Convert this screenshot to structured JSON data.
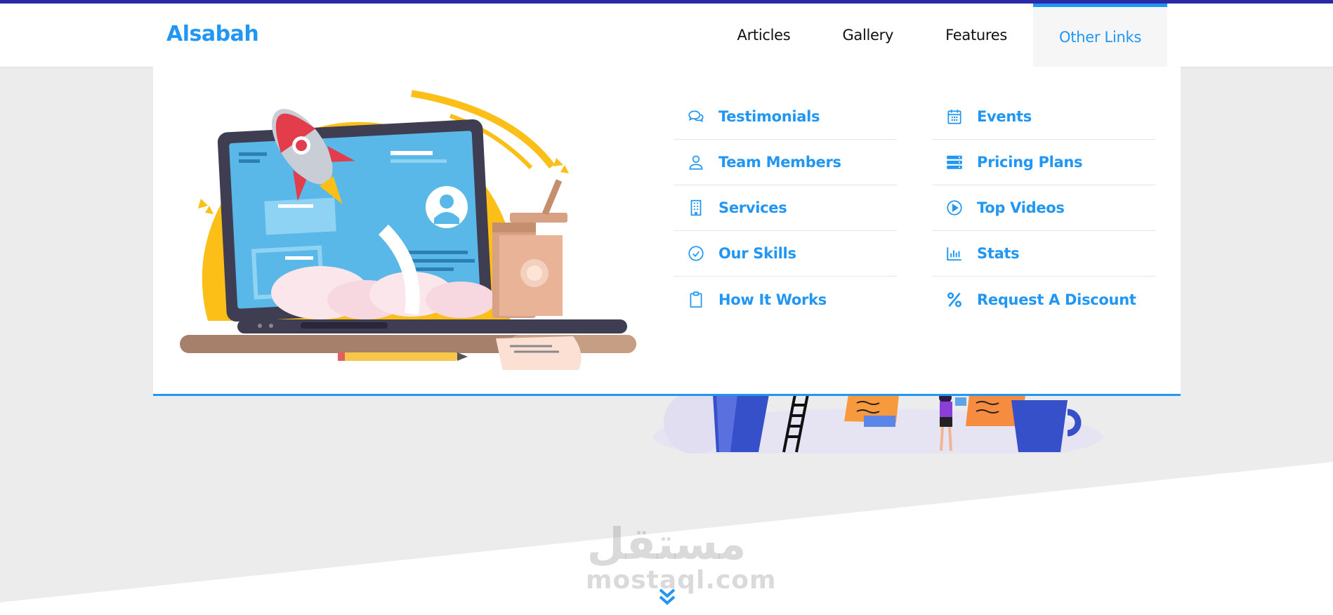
{
  "header": {
    "logo": "Alsabah",
    "nav": [
      {
        "label": "Articles"
      },
      {
        "label": "Gallery"
      },
      {
        "label": "Features"
      },
      {
        "label": "Other Links"
      }
    ]
  },
  "mega_menu": {
    "left_column": [
      {
        "label": "Testimonials",
        "icon": "comments-icon"
      },
      {
        "label": "Team Members",
        "icon": "user-icon"
      },
      {
        "label": "Services",
        "icon": "building-icon"
      },
      {
        "label": "Our Skills",
        "icon": "check-circle-icon"
      },
      {
        "label": "How It Works",
        "icon": "clipboard-icon"
      }
    ],
    "right_column": [
      {
        "label": "Events",
        "icon": "calendar-icon"
      },
      {
        "label": "Pricing Plans",
        "icon": "server-icon"
      },
      {
        "label": "Top Videos",
        "icon": "play-circle-icon"
      },
      {
        "label": "Stats",
        "icon": "chart-bar-icon"
      },
      {
        "label": "Request A Discount",
        "icon": "percent-icon"
      }
    ]
  },
  "watermark": {
    "arabic": "مستقل",
    "latin": "mostaql.com"
  },
  "colors": {
    "accent": "#2196f3",
    "top_strip": "#2a2aa8",
    "background": "#ececec"
  }
}
